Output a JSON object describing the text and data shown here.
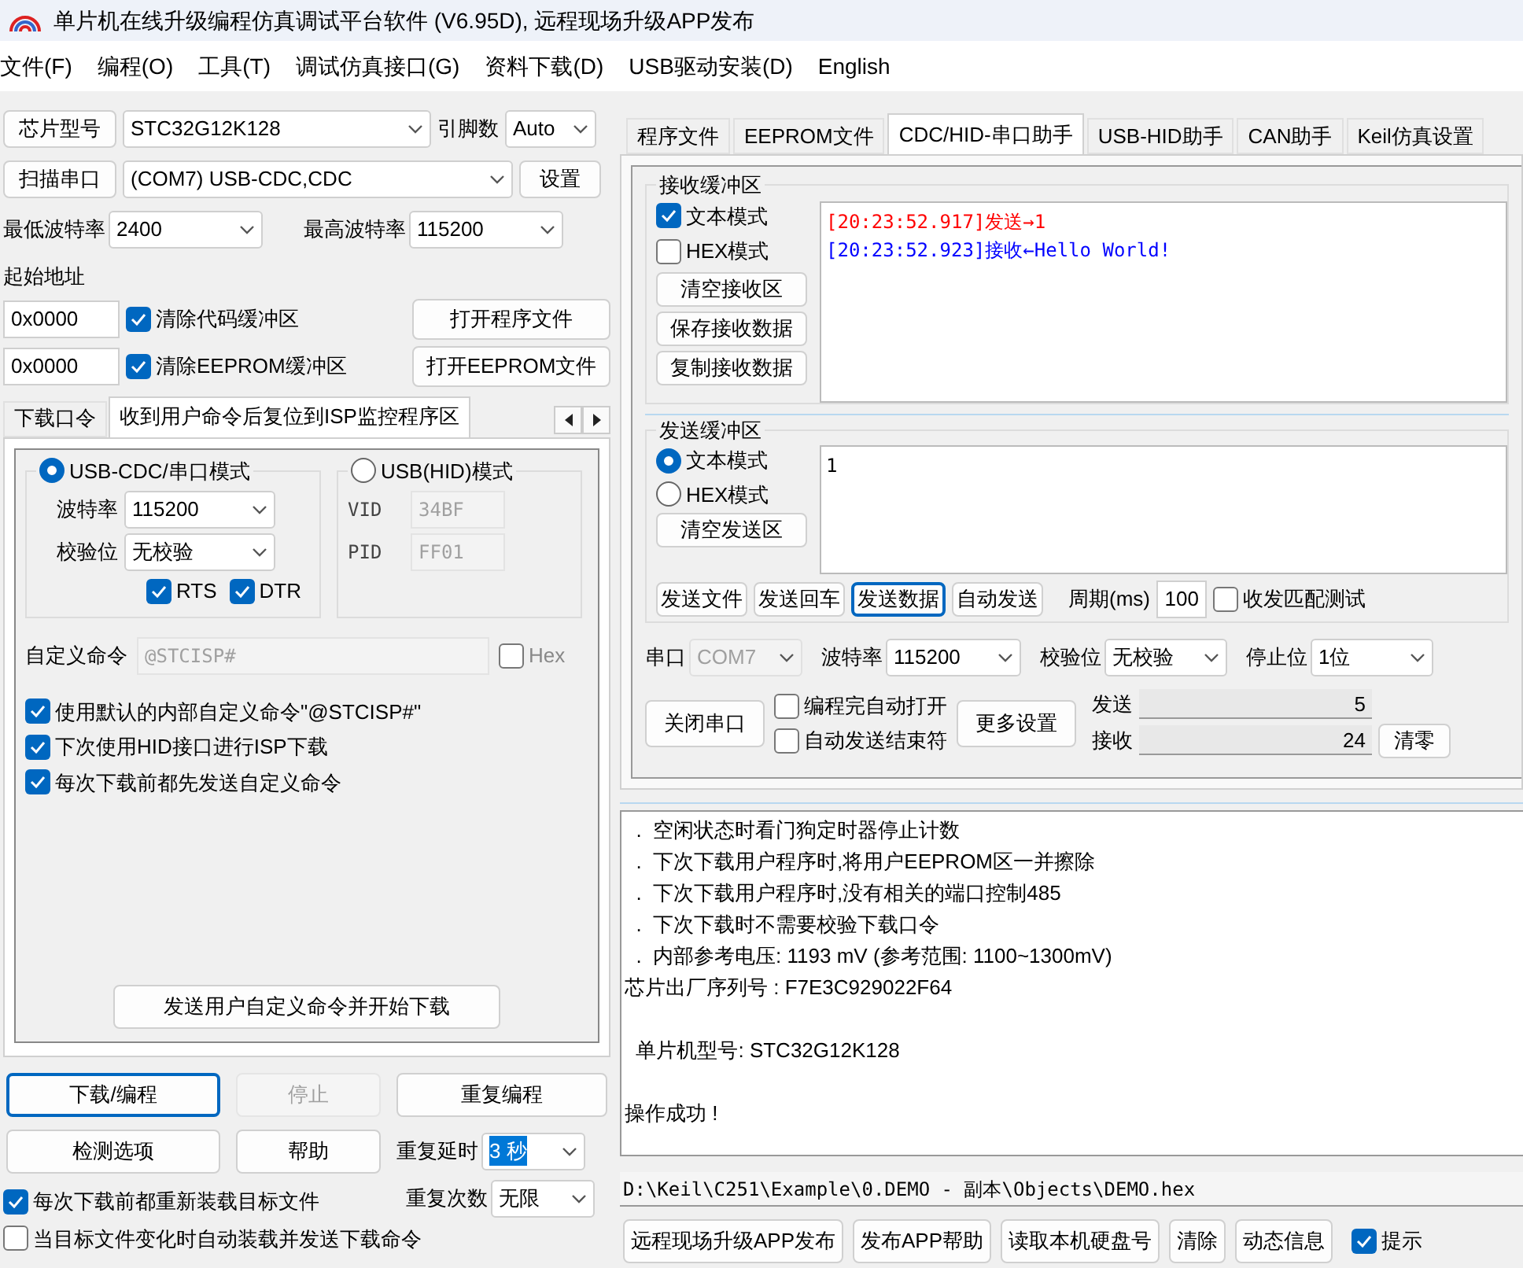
{
  "window": {
    "title": "单片机在线升级编程仿真调试平台软件 (V6.95D), 远程现场升级APP发布"
  },
  "menu": [
    "文件(F)",
    "编程(O)",
    "工具(T)",
    "调试仿真接口(G)",
    "资料下载(D)",
    "USB驱动安装(D)",
    "English"
  ],
  "chip": {
    "button": "芯片型号",
    "value": "STC32G12K128",
    "pins_label": "引脚数",
    "pins_value": "Auto"
  },
  "port": {
    "button": "扫描串口",
    "value": "(COM7) USB-CDC,CDC",
    "settings": "设置"
  },
  "baud": {
    "min_label": "最低波特率",
    "min_value": "2400",
    "max_label": "最高波特率",
    "max_value": "115200"
  },
  "start_address": {
    "label": "起始地址",
    "rows": [
      {
        "value": "0x0000",
        "option": "清除代码缓冲区",
        "checked": true,
        "button": "打开程序文件"
      },
      {
        "value": "0x0000",
        "option": "清除EEPROM缓冲区",
        "checked": true,
        "button": "打开EEPROM文件"
      }
    ]
  },
  "left_tabs": [
    {
      "label": "下载口令",
      "selected": false
    },
    {
      "label": "收到用户命令后复位到ISP监控程序区",
      "selected": true
    }
  ],
  "modes": [
    {
      "label": "USB-CDC/串口模式",
      "selected": true,
      "fields": [
        {
          "label": "波特率",
          "value": "115200"
        },
        {
          "label": "校验位",
          "value": "无校验"
        }
      ],
      "flags": [
        {
          "label": "RTS",
          "checked": true
        },
        {
          "label": "DTR",
          "checked": true
        }
      ]
    },
    {
      "label": "USB(HID)模式",
      "selected": false,
      "fields": [
        {
          "label": "VID",
          "value": "34BF"
        },
        {
          "label": "PID",
          "value": "FF01"
        }
      ]
    }
  ],
  "custom_command": {
    "label": "自定义命令",
    "value": "@STCISP#",
    "hex_label": "Hex",
    "hex_checked": false
  },
  "command_options": [
    {
      "label": "使用默认的内部自定义命令\"@STCISP#\"",
      "checked": true
    },
    {
      "label": "下次使用HID接口进行ISP下载",
      "checked": true
    },
    {
      "label": "每次下载前都先发送自定义命令",
      "checked": true
    }
  ],
  "send_command_button": "发送用户自定义命令并开始下载",
  "actions": [
    {
      "label": "下载/编程",
      "disabled": false,
      "focused": true
    },
    {
      "label": "停止",
      "disabled": true,
      "focused": false
    },
    {
      "label": "重复编程",
      "disabled": false,
      "focused": false
    },
    {
      "label": "检测选项",
      "disabled": false,
      "focused": false
    },
    {
      "label": "帮助",
      "disabled": false,
      "focused": false
    }
  ],
  "repeat": [
    {
      "label": "重复延时",
      "value": "3 秒",
      "highlighted": true
    },
    {
      "label": "重复次数",
      "value": "无限",
      "highlighted": false
    }
  ],
  "reload_options": [
    {
      "label": "每次下载前都重新装载目标文件",
      "checked": true
    },
    {
      "label": "当目标文件变化时自动装载并发送下载命令",
      "checked": false
    }
  ],
  "right_tabs": [
    {
      "label": "程序文件",
      "selected": false
    },
    {
      "label": "EEPROM文件",
      "selected": false
    },
    {
      "label": "CDC/HID-串口助手",
      "selected": true
    },
    {
      "label": "USB-HID助手",
      "selected": false
    },
    {
      "label": "CAN助手",
      "selected": false
    },
    {
      "label": "Keil仿真设置",
      "selected": false
    }
  ],
  "receive": {
    "title": "接收缓冲区",
    "modes": [
      {
        "label": "文本模式",
        "checked": true
      },
      {
        "label": "HEX模式",
        "checked": false
      }
    ],
    "buttons": [
      "清空接收区",
      "保存接收数据",
      "复制接收数据"
    ],
    "lines": [
      {
        "text": "[20:23:52.917]发送→1",
        "color": "#ff0000"
      },
      {
        "text": "[20:23:52.923]接收←Hello World!",
        "color": "#0000ff"
      }
    ]
  },
  "send": {
    "title": "发送缓冲区",
    "modes": [
      {
        "label": "文本模式",
        "selected": true
      },
      {
        "label": "HEX模式",
        "selected": false
      }
    ],
    "clear_button": "清空发送区",
    "text": "1",
    "buttons": [
      {
        "label": "发送文件",
        "focused": false
      },
      {
        "label": "发送回车",
        "focused": false
      },
      {
        "label": "发送数据",
        "focused": true
      },
      {
        "label": "自动发送",
        "focused": false
      }
    ],
    "period_label": "周期(ms)",
    "period_value": "100",
    "match": {
      "label": "收发匹配测试",
      "checked": false
    }
  },
  "serial": {
    "fields": [
      {
        "label": "串口",
        "value": "COM7",
        "disabled": true
      },
      {
        "label": "波特率",
        "value": "115200",
        "disabled": false
      },
      {
        "label": "校验位",
        "value": "无校验",
        "disabled": false
      },
      {
        "label": "停止位",
        "value": "1位",
        "disabled": false
      }
    ],
    "close_button": "关闭串口",
    "options": [
      {
        "label": "编程完自动打开",
        "checked": false
      },
      {
        "label": "自动发送结束符",
        "checked": false
      }
    ],
    "more_button": "更多设置",
    "counters": [
      {
        "label": "发送",
        "value": "5"
      },
      {
        "label": "接收",
        "value": "24"
      }
    ],
    "clear_button": "清零"
  },
  "log": [
    {
      "kind": "line",
      "text": "  .  空闲状态时看门狗定时器停止计数"
    },
    {
      "kind": "line",
      "text": "  .  下次下载用户程序时,将用户EEPROM区一并擦除"
    },
    {
      "kind": "line",
      "text": "  .  下次下载用户程序时,没有相关的端口控制485"
    },
    {
      "kind": "line",
      "text": "  .  下次下载时不需要校验下载口令"
    },
    {
      "kind": "line",
      "text": "  .  内部参考电压: 1193 mV (参考范围: 1100~1300mV)"
    },
    {
      "kind": "line",
      "text": "芯片出厂序列号 : F7E3C929022F64"
    },
    {
      "kind": "gap"
    },
    {
      "kind": "line",
      "text": "  单片机型号: STC32G12K128"
    },
    {
      "kind": "gap"
    },
    {
      "kind": "line",
      "text": "操作成功 !"
    }
  ],
  "file_path": "D:\\Keil\\C251\\Example\\0.DEMO - 副本\\Objects\\DEMO.hex",
  "bottom_buttons": [
    "远程现场升级APP发布",
    "发布APP帮助",
    "读取本机硬盘号",
    "清除",
    "动态信息"
  ],
  "hint": {
    "label": "提示",
    "checked": true
  }
}
